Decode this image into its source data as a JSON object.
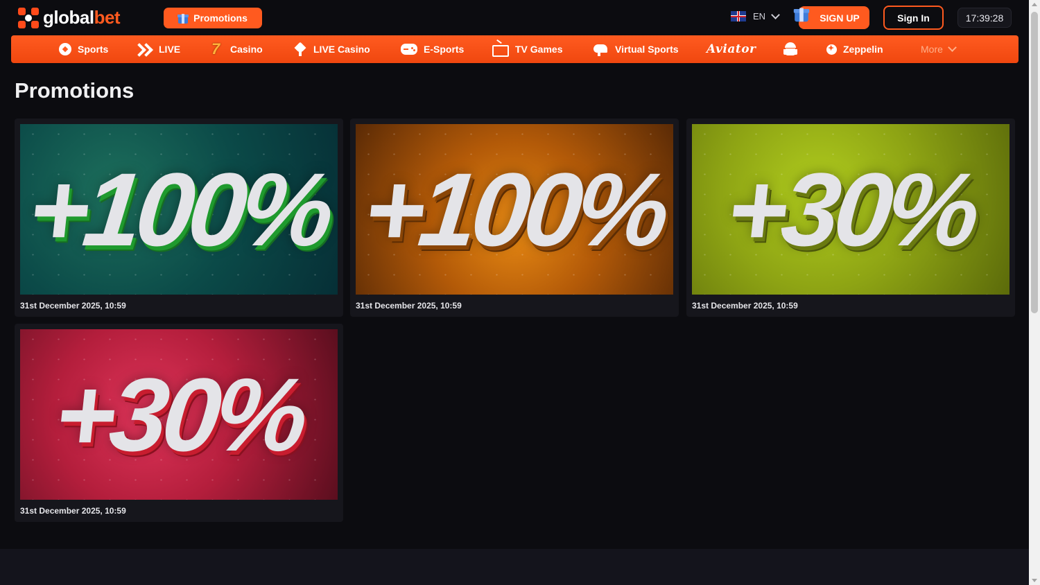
{
  "header": {
    "logo_part1": "global",
    "logo_part2": "bet",
    "promotions_button": "Promotions",
    "language": "EN",
    "signup_button": "SIGN UP",
    "signin_button": "Sign In",
    "clock": "17:39:28"
  },
  "nav": {
    "items": [
      {
        "label": "Sports",
        "icon": "soccer-ball-icon"
      },
      {
        "label": "LIVE",
        "icon": "double-chevron-icon"
      },
      {
        "label": "Casino",
        "icon": "seven-icon"
      },
      {
        "label": "LIVE Casino",
        "icon": "spade-icon"
      },
      {
        "label": "E-Sports",
        "icon": "gamepad-icon"
      },
      {
        "label": "TV Games",
        "icon": "tv-icon"
      },
      {
        "label": "Virtual Sports",
        "icon": "horse-icon"
      },
      {
        "label": "Aviator",
        "icon": "aviator-logo"
      },
      {
        "label": "",
        "icon": "android-icon"
      },
      {
        "label": "Zeppelin",
        "icon": "zeppelin-icon"
      }
    ],
    "more": "More"
  },
  "main": {
    "title": "Promotions",
    "promos": [
      {
        "banner_text": "+100%",
        "date": "31st December 2025, 10:59",
        "theme": "green"
      },
      {
        "banner_text": "+100%",
        "date": "31st December 2025, 10:59",
        "theme": "orange"
      },
      {
        "banner_text": "+30%",
        "date": "31st December 2025, 10:59",
        "theme": "lime"
      },
      {
        "banner_text": "+30%",
        "date": "31st December 2025, 10:59",
        "theme": "red"
      }
    ]
  },
  "colors": {
    "accent": "#ff5a1f",
    "background": "#0c0c10",
    "card": "#16161c"
  }
}
